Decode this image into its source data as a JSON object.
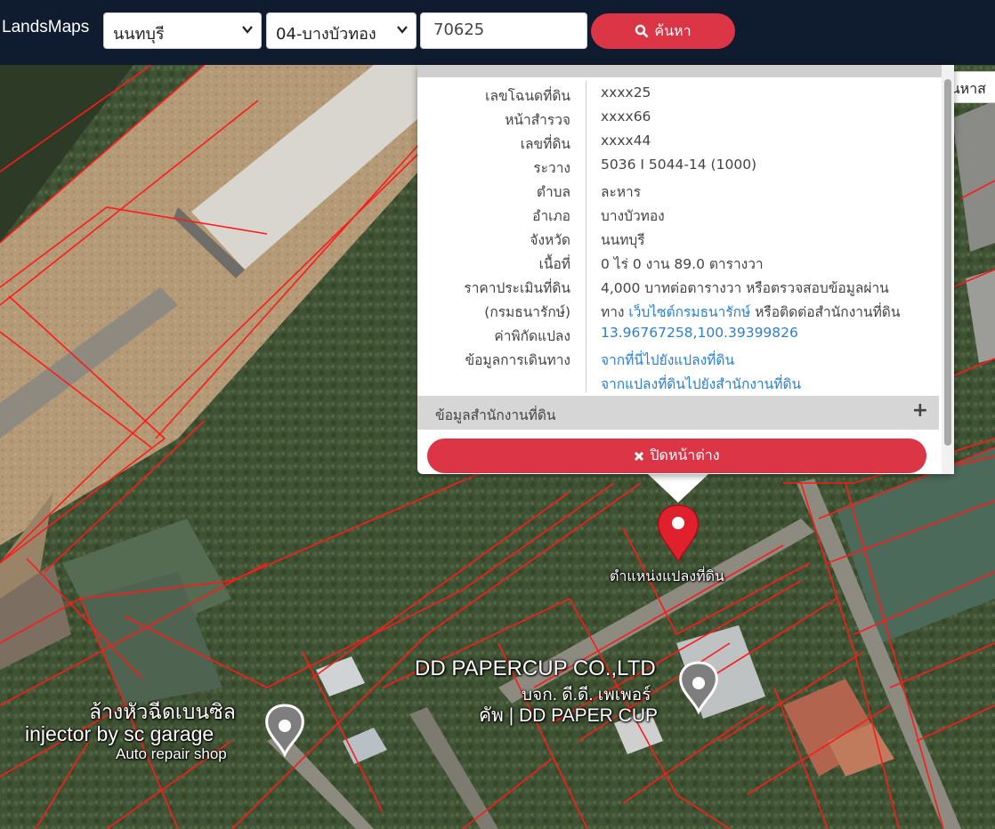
{
  "header": {
    "brand": "LandsMaps",
    "province_select": "นนทบุรี",
    "district_select": "04-บางบัวทอง",
    "parcel_input": "70625",
    "search_button": "ค้นหา"
  },
  "side_search": {
    "label": "ค้นหาส"
  },
  "popup": {
    "rows": [
      {
        "key": "เลขโฉนดที่ดิน",
        "value": "xxxx25"
      },
      {
        "key": "หน้าสำรวจ",
        "value": "xxxx66"
      },
      {
        "key": "เลขที่ดิน",
        "value": "xxxx44"
      },
      {
        "key": "ระวาง",
        "value": "5036 I 5044-14 (1000)"
      },
      {
        "key": "ตำบล",
        "value": "ละหาร"
      },
      {
        "key": "อำเภอ",
        "value": "บางบัวทอง"
      },
      {
        "key": "จังหวัด",
        "value": "นนทบุรี"
      },
      {
        "key": "เนื้อที่",
        "value": "0 ไร่ 0 งาน 89.0 ตารางวา"
      }
    ],
    "price": {
      "key1": "ราคาประเมินที่ดิน",
      "key2": "(กรมธนารักษ์)",
      "line1": "4,000 บาทต่อตารางวา หรือตรวจสอบข้อมูลผ่าน",
      "line2_pre": "ทาง ",
      "line2_link": "เว็บไซต์กรมธนารักษ์",
      "line2_post": " หรือติดต่อสำนักงานที่ดิน"
    },
    "coord": {
      "key": "ค่าพิกัดแปลง",
      "value": "13.96767258,100.39399826"
    },
    "travel": {
      "key": "ข้อมูลการเดินทาง",
      "link1": "จากที่นี่ไปยังแปลงที่ดิน",
      "link2": "จากแปลงที่ดินไปยังสำนักงานที่ดิน"
    },
    "office_section": "ข้อมูลสำนักงานที่ดิน",
    "close_button": "ปิดหน้าต่าง"
  },
  "map": {
    "marker_label": "ตำแหน่งแปลงที่ดิน",
    "places": [
      {
        "line1": "DD PAPERCUP CO.,LTD",
        "line2": "บจก. ดี.ดี. เพเพอร์",
        "line3": "คัพ | DD PAPER CUP"
      },
      {
        "line1": "ล้างหัวฉีดเบนซิล",
        "line2": "injector by sc garage",
        "line3": "Auto repair shop"
      }
    ]
  },
  "colors": {
    "header_bg": "#0f1b2e",
    "accent_red": "#dc3545",
    "link_blue": "#2a7fd4",
    "parcel_line": "#ff1a1a"
  }
}
